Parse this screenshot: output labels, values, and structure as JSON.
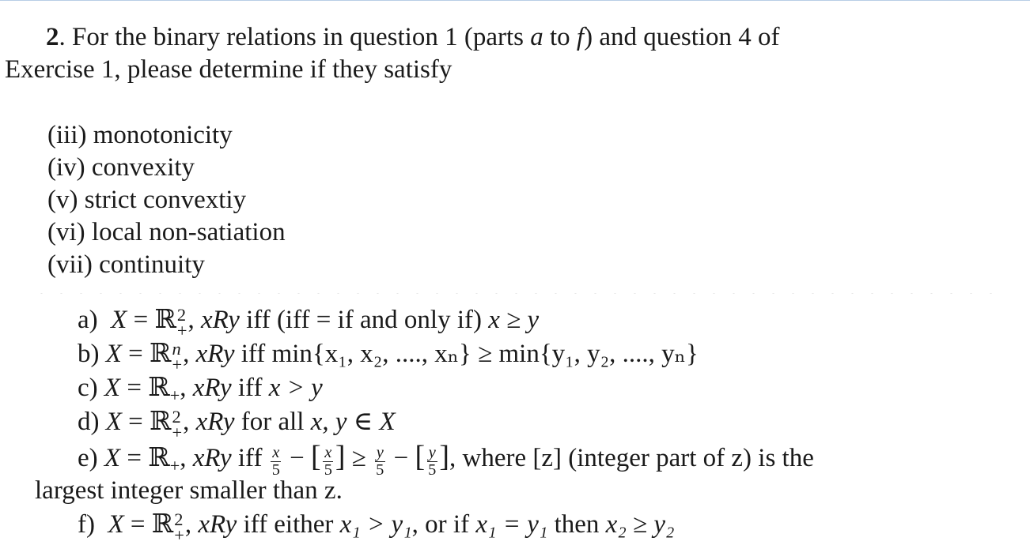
{
  "question": {
    "number": "2",
    "intro_line1": ". For the binary relations in question 1 (parts ",
    "intro_a": "a",
    "intro_to": " to ",
    "intro_f": "f",
    "intro_rest": ") and question 4 of",
    "intro_line2": "Exercise 1, please determine if they satisfy"
  },
  "properties": [
    {
      "label": "(iii)",
      "text": "monotonicity"
    },
    {
      "label": "(iv)",
      "text": "convexity"
    },
    {
      "label": "(v)",
      "text": "strict convextiy"
    },
    {
      "label": "(vi)",
      "text": "local non-satiation"
    },
    {
      "label": "(vii)",
      "text": "continuity"
    }
  ],
  "parts": {
    "a": {
      "label": "a)",
      "set": "ℝ",
      "sup": "2",
      "sub": "+",
      "relation": "xRy",
      "condition_text": "iff (iff = if and only if)",
      "condition_math": "x ≥ y"
    },
    "b": {
      "label": "b)",
      "set": "ℝ",
      "sup": "n",
      "sub": "+",
      "relation": "xRy",
      "iff": "iff",
      "lhs": "min{x₁, x₂, ...., xₙ}",
      "op": "≥",
      "rhs": "min{y₁, y₂, ...., yₙ}"
    },
    "c": {
      "label": "c)",
      "set": "ℝ",
      "sub": "+",
      "relation": "xRy",
      "iff": "iff",
      "condition_math": "x > y"
    },
    "d": {
      "label": "d)",
      "set": "ℝ",
      "sup": "2",
      "sub": "+",
      "relation": "xRy",
      "condition_text": "for all",
      "condition_math": "x, y ∈ X"
    },
    "e": {
      "label": "e)",
      "set": "ℝ",
      "sub": "+",
      "relation": "xRy",
      "iff": "iff",
      "frac_x": "x",
      "frac_y": "y",
      "denom": "5",
      "tail": ", where [z] (integer part of z) is the",
      "line2": "largest integer smaller than z."
    },
    "f": {
      "label": "f)",
      "set": "ℝ",
      "sup": "2",
      "sub": "+",
      "relation": "xRy",
      "condition_text": "iff either",
      "c1": "x₁ > y₁",
      "or_if": ", or if",
      "c2": "x₁ = y₁",
      "then": "then",
      "c3": "x₂ ≥ y₂"
    }
  }
}
